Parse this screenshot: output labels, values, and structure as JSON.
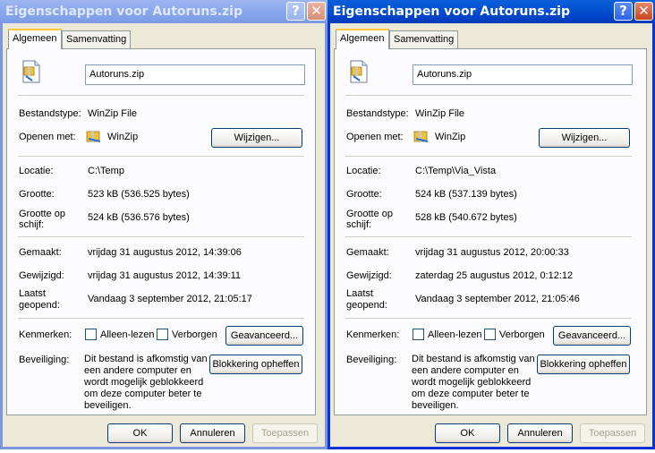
{
  "dialogs": [
    {
      "title": "Eigenschappen voor Autoruns.zip",
      "tabs": [
        "Algemeen",
        "Samenvatting"
      ],
      "filename": "Autoruns.zip",
      "labels": {
        "type": "Bestandstype:",
        "open_with": "Openen met:",
        "location": "Locatie:",
        "size": "Grootte:",
        "size_on_disk_1": "Grootte op",
        "size_on_disk_2": "schijf:",
        "created": "Gemaakt:",
        "modified": "Gewijzigd:",
        "accessed_1": "Laatst",
        "accessed_2": "geopend:",
        "attributes": "Kenmerken:",
        "security": "Beveiliging:"
      },
      "type": "WinZip File",
      "open_with": "WinZip",
      "change_button": "Wijzigen...",
      "location": "C:\\Temp",
      "size": "523 kB (536.525 bytes)",
      "size_on_disk": "524 kB (536.576 bytes)",
      "created": "vrijdag 31 augustus 2012, 14:39:06",
      "modified": "vrijdag 31 augustus 2012, 14:39:11",
      "accessed": "Vandaag 3 september 2012, 21:05:17",
      "readonly_label": "Alleen-lezen",
      "hidden_label": "Verborgen",
      "advanced_button": "Geavanceerd...",
      "security_text": "Dit bestand is afkomstig van een andere computer en wordt mogelijk geblokkeerd om deze computer beter te beveiligen.",
      "unblock_button": "Blokkering opheffen",
      "ok_button": "OK",
      "cancel_button": "Annuleren",
      "apply_button": "Toepassen"
    },
    {
      "title": "Eigenschappen voor Autoruns.zip",
      "tabs": [
        "Algemeen",
        "Samenvatting"
      ],
      "filename": "Autoruns.zip",
      "labels": {
        "type": "Bestandstype:",
        "open_with": "Openen met:",
        "location": "Locatie:",
        "size": "Grootte:",
        "size_on_disk_1": "Grootte op",
        "size_on_disk_2": "schijf:",
        "created": "Gemaakt:",
        "modified": "Gewijzigd:",
        "accessed_1": "Laatst",
        "accessed_2": "geopend:",
        "attributes": "Kenmerken:",
        "security": "Beveiliging:"
      },
      "type": "WinZip File",
      "open_with": "WinZip",
      "change_button": "Wijzigen...",
      "location": "C:\\Temp\\Via_Vista",
      "size": "524 kB (537.139 bytes)",
      "size_on_disk": "528 kB (540.672 bytes)",
      "created": "vrijdag 31 augustus 2012, 20:00:33",
      "modified": "zaterdag 25 augustus 2012, 0:12:12",
      "accessed": "Vandaag 3 september 2012, 21:05:46",
      "readonly_label": "Alleen-lezen",
      "hidden_label": "Verborgen",
      "advanced_button": "Geavanceerd...",
      "security_text": "Dit bestand is afkomstig van een andere computer en wordt mogelijk geblokkeerd om deze computer beter te beveiligen.",
      "unblock_button": "Blokkering opheffen",
      "ok_button": "OK",
      "cancel_button": "Annuleren",
      "apply_button": "Toepassen"
    }
  ],
  "icons": {
    "help": "help-icon",
    "close": "close-icon",
    "file": "zip-file-icon",
    "app": "winzip-icon"
  },
  "colors": {
    "active_title": "#0453d1",
    "inactive_title": "#8aa7ec",
    "dialog_bg": "#ece9d8",
    "tab_accent": "#ffc83c"
  }
}
